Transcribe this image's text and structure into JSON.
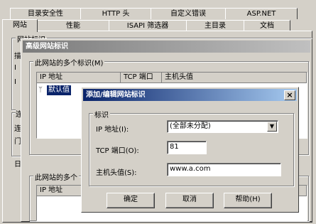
{
  "tabs_row1": [
    "目录安全性",
    "HTTP 头",
    "自定义错误",
    "ASP.NET"
  ],
  "tabs_row2": [
    "网站",
    "性能",
    "ISAPI 筛选器",
    "主目录",
    "文档"
  ],
  "bg_dialog": {
    "partial_label": "网站标识",
    "partial_left_chars": [
      "描",
      "I",
      "I",
      "连",
      "连",
      "门",
      "日"
    ]
  },
  "adv_dialog": {
    "title": "高级网站标识",
    "group_label": "此网站的多个标识(M)",
    "columns": [
      "IP 地址",
      "TCP 端口",
      "主机头值"
    ],
    "rows": [
      {
        "ip": "默认值"
      }
    ],
    "group2_label": "此网站的多个",
    "columns2": [
      "IP 地址"
    ]
  },
  "edit_dialog": {
    "title": "添加/编辑网站标识",
    "close_label": "×",
    "group_label": "标识",
    "ip_label": "IP 地址(I):",
    "ip_value": "(全部未分配)",
    "port_label": "TCP 端口(O):",
    "port_value": "81",
    "host_label": "主机头值(S):",
    "host_value": "www.a.com",
    "ok": "确定",
    "cancel": "取消",
    "help": "帮助(H)"
  }
}
